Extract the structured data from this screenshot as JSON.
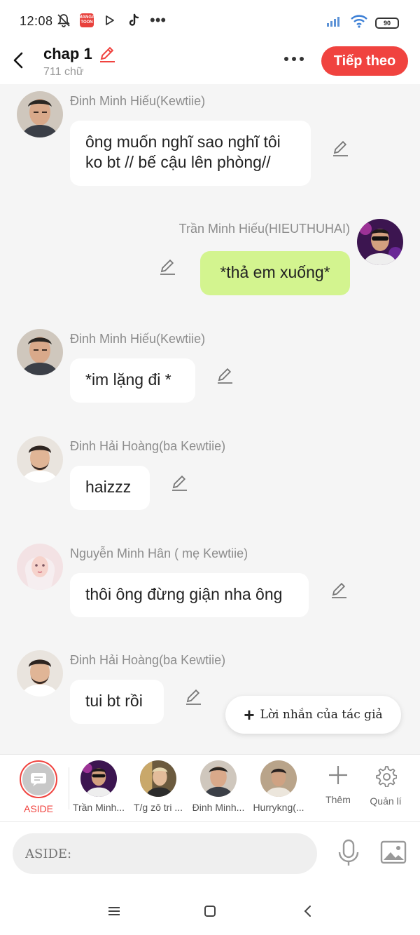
{
  "status_bar": {
    "time": "12:08",
    "battery": "90"
  },
  "header": {
    "title": "chap 1",
    "word_count": "711 chữ",
    "next_label": "Tiếp theo"
  },
  "messages": [
    {
      "name": "Đinh Minh Hiếu(Kewtiie)",
      "text": "ông muốn nghĩ sao nghĩ tôi\nko bt // bế cậu lên phòng//"
    },
    {
      "name": "Trần Minh Hiếu(HIEUTHUHAI)",
      "text": "*thả em xuống*"
    },
    {
      "name": "Đinh Minh Hiếu(Kewtiie)",
      "text": "*im lặng đi *"
    },
    {
      "name": "Đinh Hải Hoàng(ba Kewtiie)",
      "text": "haizzz"
    },
    {
      "name": "Nguyễn Minh Hân ( mẹ Kewtiie)",
      "text": "thôi ông đừng giận nha ông"
    },
    {
      "name": "Đinh Hải Hoàng(ba Kewtiie)",
      "text": "tui bt rồi"
    }
  ],
  "author_note": {
    "label": "Lời nhắn của tác giả"
  },
  "characters": [
    {
      "label": "ASIDE"
    },
    {
      "label": "Trần Minh..."
    },
    {
      "label": "T/g zô tri ..."
    },
    {
      "label": "Đinh Minh..."
    },
    {
      "label": "Hurrykng(..."
    }
  ],
  "tools": {
    "add_label": "Thêm",
    "manage_label": "Quản lí"
  },
  "input": {
    "placeholder": "ASIDE:"
  },
  "colors": {
    "accent": "#f0433f",
    "bubble_self": "#d3f48f",
    "bubble_other": "#ffffff",
    "background": "#f5f5f5"
  }
}
